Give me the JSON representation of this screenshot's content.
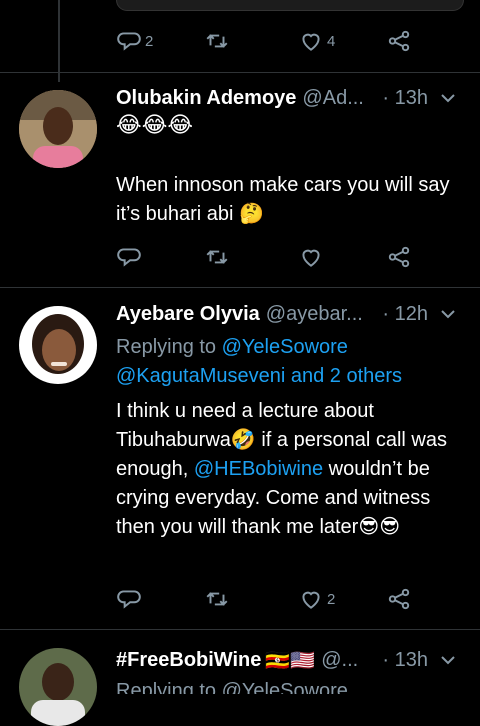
{
  "tweet0": {
    "reply_count": "2",
    "retweet_count": "",
    "like_count": "4"
  },
  "tweet1": {
    "name": "Olubakin Ademoye",
    "handle": "@Ad...",
    "time": "· 13h",
    "emoji_line": "😂😂😂",
    "text": "When innoson make cars you will say it’s buhari abi",
    "text_emoji": "🤔",
    "reply_count": "",
    "retweet_count": "",
    "like_count": ""
  },
  "tweet2": {
    "name": "Ayebare Olyvia",
    "handle": "@ayebar...",
    "time": "· 12h",
    "replying_prefix": "Replying to",
    "replying_user1": "@YeleSowore",
    "replying_user2": "@KagutaMuseveni and 2 others",
    "text_part1": "I think u need a lecture about Tibuhaburwa",
    "emoji1": "🤣",
    "text_part2": " if a personal call was enough, ",
    "mention": "@HEBobiwine",
    "text_part3": " wouldn’t be crying everyday. Come and witness then you will thank me later",
    "emoji2": "😎😎",
    "reply_count": "",
    "retweet_count": "",
    "like_count": "2"
  },
  "tweet3": {
    "name": "#FreeBobiWine",
    "flags": "🇺🇬🇺🇸",
    "handle": "@...",
    "time": "· 13h",
    "replying_partial": "Replying to @YeleSowore"
  },
  "colors": {
    "background": "#000000",
    "muted": "#8899a6",
    "link": "#1da1f2",
    "divider": "#2f3336"
  }
}
